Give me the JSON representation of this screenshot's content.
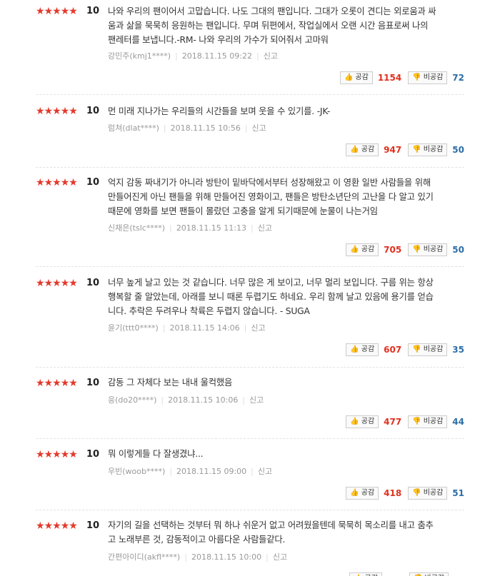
{
  "labels": {
    "like": "공감",
    "dislike": "비공감",
    "report": "신고"
  },
  "colors": {
    "star": "#e33a2c",
    "like_count": "#e0301e",
    "dislike_count": "#2c6ea8"
  },
  "reviews": [
    {
      "stars": 5,
      "score": "10",
      "lines": [
        "나와 우리의 팬이어서 고맙습니다. 나도 그대의 팬입니다. 그대가 오롯이 견디는 외로움과 싸",
        "움과 삶을 묵묵히 응원하는 팬입니다. 무며 뒤편에서, 작업실에서 오랜 시간 음표로써 나의",
        "팬레터를 보냅니다.-RM- 나와 우리의 가수가 되어줘서 고마워"
      ],
      "author": "강민주(kmj1****)",
      "date": "2018.11.15 09:22",
      "likes": "1154",
      "dislikes": "72"
    },
    {
      "stars": 5,
      "score": "10",
      "lines": [
        "먼 미래 지나가는 우리들의 시간들을 보며 웃을 수 있기를. -JK-"
      ],
      "author": "럼쳐(dlat****)",
      "date": "2018.11.15 10:56",
      "likes": "947",
      "dislikes": "50"
    },
    {
      "stars": 5,
      "score": "10",
      "lines": [
        "억지 감동 짜내기가 아니라 방탄이 밑바닥에서부터 성장해왔고 이 영환 일반 사람들을 위해",
        "만들어진게 아닌 팬들을 위해 만들어진 영화이고, 팬들은 방탄소년단의 고난을 다 알고 있기",
        "때문에 영화를 보면 팬들이 몰랐던 고충을 알게 되기때문에 눈물이 나는거임"
      ],
      "author": "신채은(tslc****)",
      "date": "2018.11.15 11:13",
      "likes": "705",
      "dislikes": "50"
    },
    {
      "stars": 5,
      "score": "10",
      "lines": [
        "너무 높게 날고 있는 것 같습니다. 너무 많은 게 보이고, 너무 멀리 보입니다. 구름 위는 항상",
        "행복할 줄 알았는데, 아래를 보니 때론 두렵기도 하네요. 우리 함께 날고 있음에 용기를 얻습",
        "니다. 추락은 두려우나 착륙은 두렵지 않습니다. - SUGA"
      ],
      "author": "윤기(ttt0****)",
      "date": "2018.11.15 14:06",
      "likes": "607",
      "dislikes": "35"
    },
    {
      "stars": 5,
      "score": "10",
      "lines": [
        "감동 그 자체다 보는 내내 울컥했음"
      ],
      "author": "응(do20****)",
      "date": "2018.11.15 10:06",
      "likes": "477",
      "dislikes": "44"
    },
    {
      "stars": 5,
      "score": "10",
      "lines": [
        "뭐 이렇게들 다 잘생겼냐..."
      ],
      "author": "우빈(woob****)",
      "date": "2018.11.15 09:00",
      "likes": "418",
      "dislikes": "51"
    },
    {
      "stars": 5,
      "score": "10",
      "lines": [
        "자기의 길을 선택하는 것부터 뭐 하나 쉬운거 없고 어려웠을텐데 묵묵히 목소리를 내고 춤추",
        "고 노래부른 것, 감동적이고 아름다운 사람들같다."
      ],
      "author": "간편아이디(akfl****)",
      "date": "2018.11.15 10:00",
      "likes": "",
      "dislikes": ""
    }
  ]
}
